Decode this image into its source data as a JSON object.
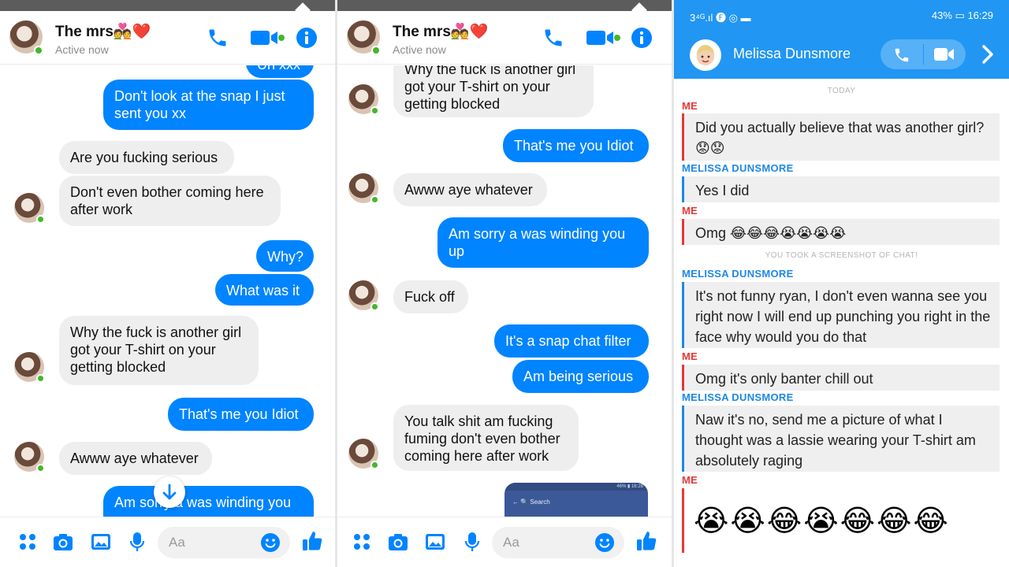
{
  "messenger": {
    "contact_name": "The mrs💑❤️",
    "active_status": "Active now",
    "composer_placeholder": "Aa",
    "panel1_messages": [
      {
        "dir": "out",
        "text": "Uh xxx"
      },
      {
        "dir": "out",
        "text": "Don't look at the snap I just sent you xx"
      },
      {
        "dir": "in",
        "text": "Are you fucking serious"
      },
      {
        "dir": "in",
        "text": "Don't even bother coming here after work"
      },
      {
        "dir": "out",
        "text": "Why?"
      },
      {
        "dir": "out",
        "text": "What was it"
      },
      {
        "dir": "in",
        "text": "Why the fuck is another girl got your T-shirt on your getting blocked"
      },
      {
        "dir": "out",
        "text": "That's me you Idiot"
      },
      {
        "dir": "in",
        "text": "Awww aye whatever"
      },
      {
        "dir": "out",
        "text": "Am sorry a was winding you up"
      }
    ],
    "panel2_messages": [
      {
        "dir": "in",
        "text": "Why the fuck is another girl got your T-shirt on your getting blocked"
      },
      {
        "dir": "out",
        "text": "That's me you Idiot"
      },
      {
        "dir": "in",
        "text": "Awww aye whatever"
      },
      {
        "dir": "out",
        "text": "Am sorry a was winding you up"
      },
      {
        "dir": "in",
        "text": "Fuck off"
      },
      {
        "dir": "out",
        "text": "It's a snap chat filter"
      },
      {
        "dir": "out",
        "text": "Am being serious"
      },
      {
        "dir": "in",
        "text": "You talk shit am fucking fuming don't even bother coming here after work"
      }
    ],
    "thumbnail": {
      "status_text": "46% ▮ 16:28",
      "search_text": "Search"
    }
  },
  "snapchat": {
    "status_bar": {
      "left": "3⁴ᴳ.ıl 🅕 ◎ ▬",
      "battery": "43%",
      "time": "16:29"
    },
    "contact_name": "Melissa Dunsmore",
    "today_label": "TODAY",
    "screenshot_notice": "YOU TOOK A SCREENSHOT OF CHAT!",
    "me_label": "ME",
    "her_label": "MELISSA DUNSMORE",
    "messages": [
      {
        "from": "me",
        "text": "Did you actually believe that was another girl? 😟😟"
      },
      {
        "from": "her",
        "text": "Yes I did"
      },
      {
        "from": "me",
        "text": "Omg 😂😂😂😭😭😭😭"
      },
      {
        "from": "her",
        "text": "It's not funny ryan, I don't even wanna see you right now I will end up punching you right in the face why would you do that"
      },
      {
        "from": "me",
        "text": "Omg it's only banter chill out"
      },
      {
        "from": "her",
        "text": "Naw it's no, send me a picture of what I thought was a lassie wearing your T-shirt am absolutely raging"
      },
      {
        "from": "me",
        "text": "😭😭😂😭😂😂😂"
      }
    ]
  },
  "colors": {
    "messenger_blue": "#0084ff",
    "snap_blue": "#2196f3",
    "me_red": "#e53935",
    "her_blue": "#1e88e5",
    "online_green": "#42b72a"
  }
}
